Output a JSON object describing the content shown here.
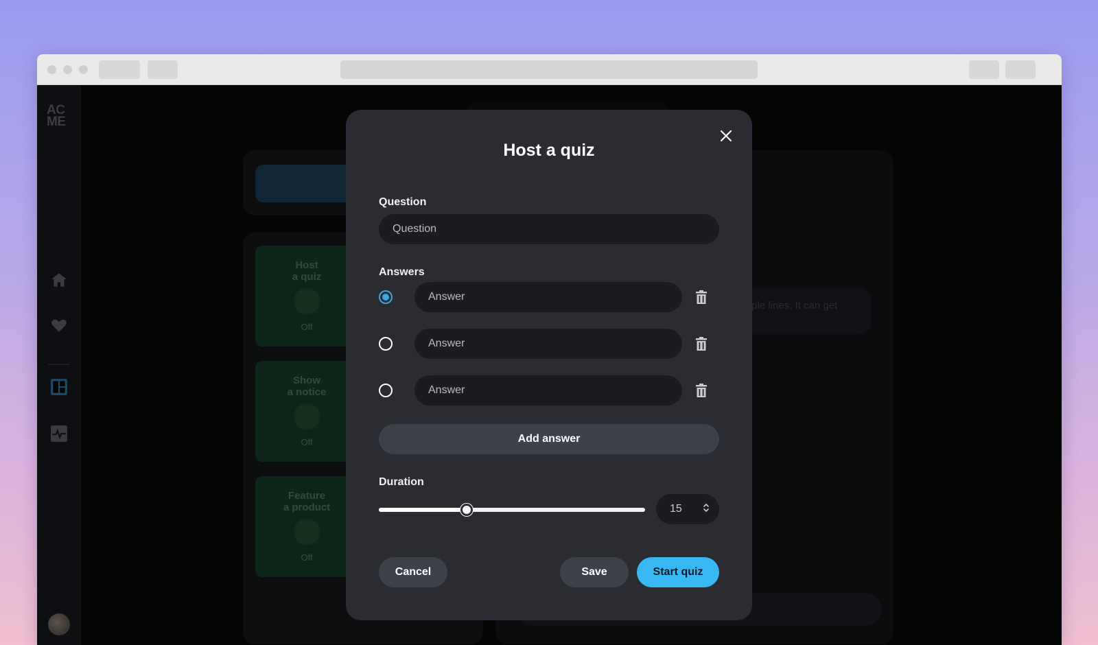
{
  "sidebar": {
    "logo": "AC\nME",
    "items": [
      {
        "icon": "home-icon"
      },
      {
        "icon": "heart-icon"
      },
      {
        "icon": "dashboard-icon",
        "active": true
      },
      {
        "icon": "activity-icon"
      }
    ]
  },
  "background": {
    "tiles": [
      {
        "title": "Host\na quiz",
        "status": "Off"
      },
      {
        "title": "Show\na notice",
        "status": "Off"
      },
      {
        "title": "Feature\na product",
        "status": "Off"
      }
    ],
    "bubble_text": "ultiple lines. It can get"
  },
  "modal": {
    "title": "Host a quiz",
    "question_label": "Question",
    "question_placeholder": "Question",
    "answers_label": "Answers",
    "answers": [
      {
        "placeholder": "Answer",
        "selected": true
      },
      {
        "placeholder": "Answer",
        "selected": false
      },
      {
        "placeholder": "Answer",
        "selected": false
      }
    ],
    "add_answer_label": "Add answer",
    "duration_label": "Duration",
    "duration_value": "15",
    "duration_slider_fraction": 0.33,
    "cancel_label": "Cancel",
    "save_label": "Save",
    "start_label": "Start quiz"
  },
  "colors": {
    "accent": "#39b7f2",
    "radio_selected": "#39a8e6",
    "modal_bg": "#2a2c32"
  }
}
